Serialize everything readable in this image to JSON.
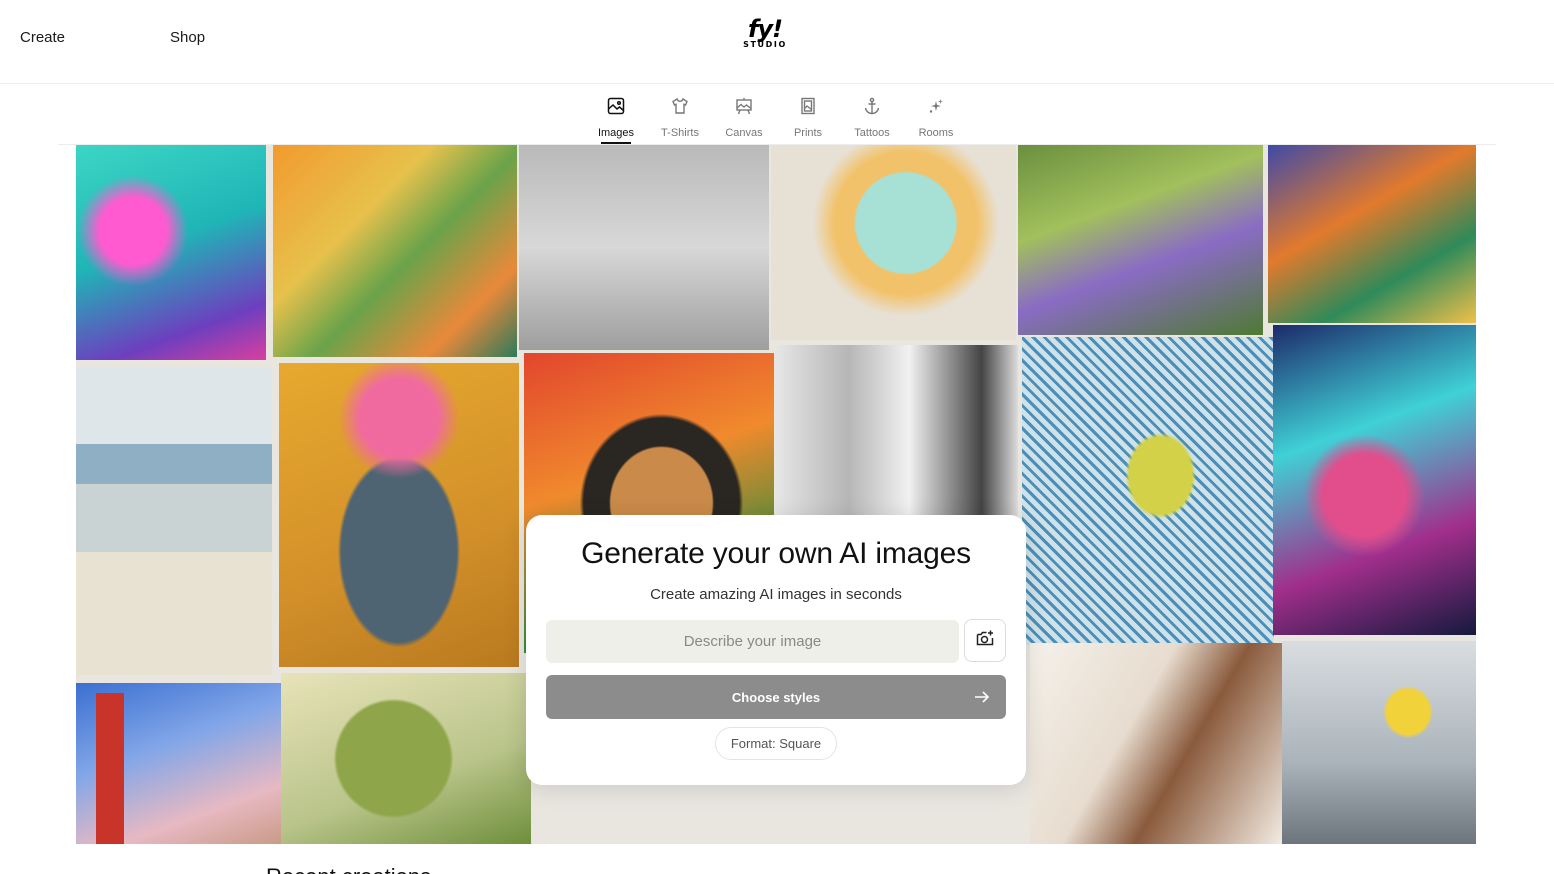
{
  "header": {
    "nav": [
      {
        "label": "Create"
      },
      {
        "label": "Shop"
      }
    ],
    "logo": {
      "main": "fy!",
      "sub": "STUDIO"
    }
  },
  "tabs": [
    {
      "label": "Images",
      "icon": "image-icon",
      "active": true
    },
    {
      "label": "T-Shirts",
      "icon": "tshirt-icon",
      "active": false
    },
    {
      "label": "Canvas",
      "icon": "canvas-icon",
      "active": false
    },
    {
      "label": "Prints",
      "icon": "print-frame-icon",
      "active": false
    },
    {
      "label": "Tattoos",
      "icon": "anchor-icon",
      "active": false
    },
    {
      "label": "Rooms",
      "icon": "sparkles-icon",
      "active": false
    }
  ],
  "generator": {
    "title": "Generate your own AI images",
    "subtitle": "Create amazing AI images in seconds",
    "input_placeholder": "Describe your image",
    "input_value": "",
    "upload_icon": "camera-plus-icon",
    "choose_label": "Choose styles",
    "format_label": "Format: Square"
  },
  "below": {
    "heading": "Recent creations"
  },
  "colors": {
    "text": "#111111",
    "muted": "#777777",
    "input_bg": "#efefea",
    "button_disabled": "#8c8c8c"
  }
}
